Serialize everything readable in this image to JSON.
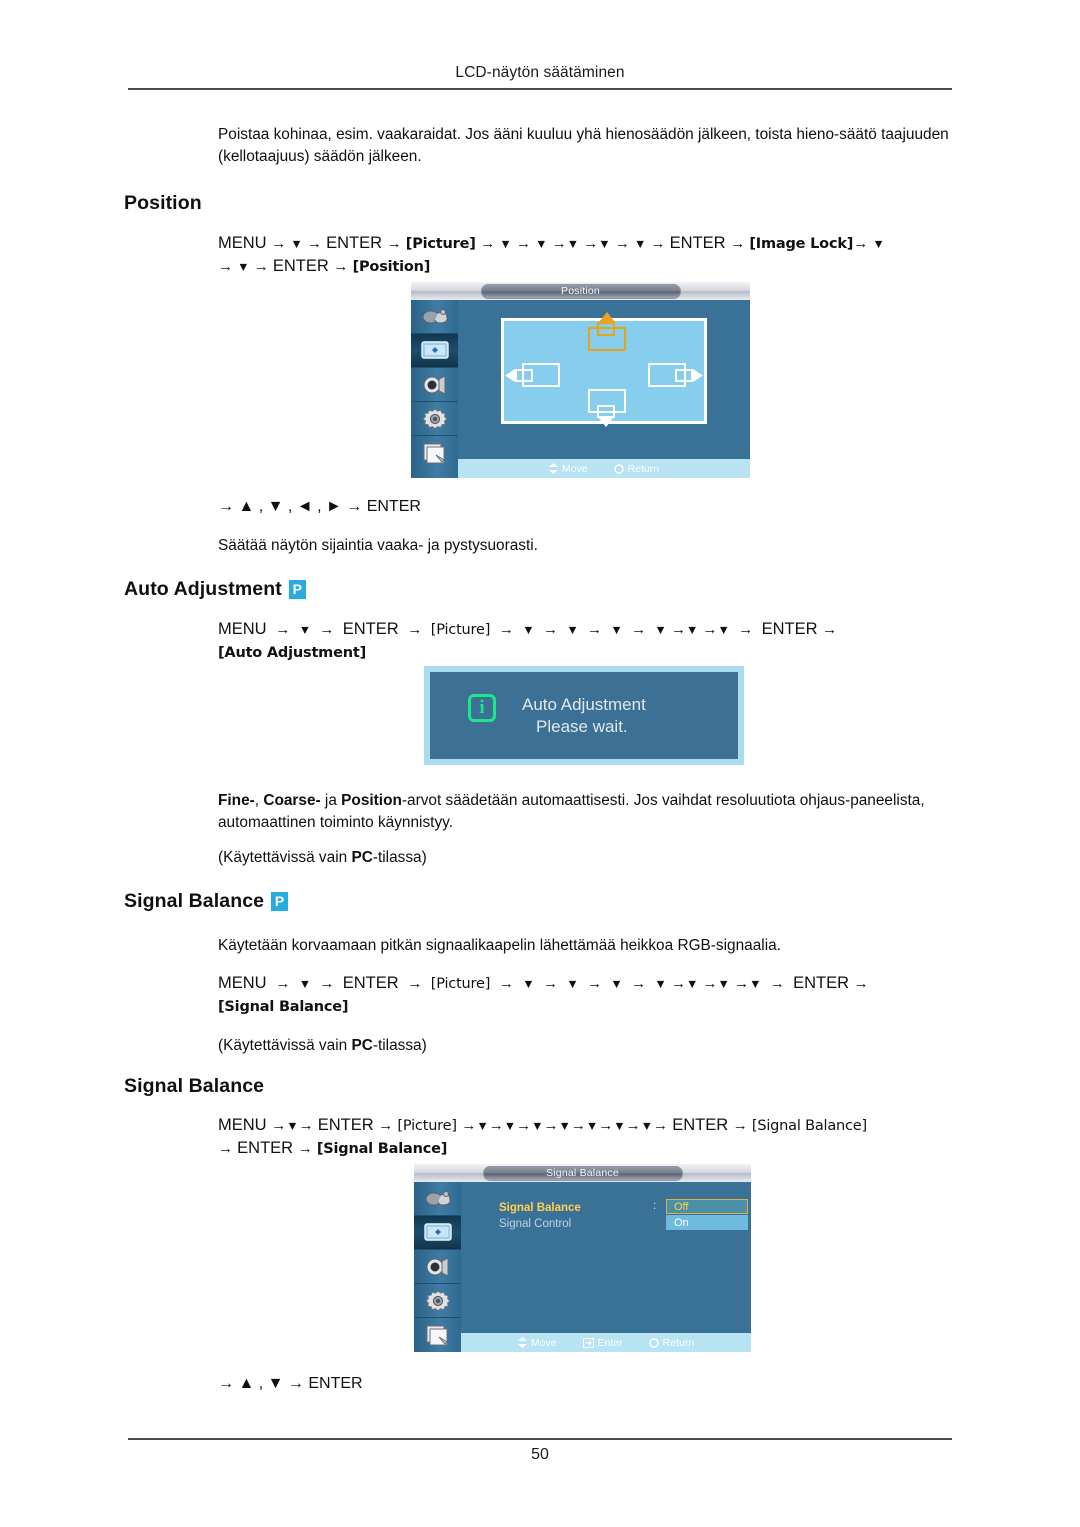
{
  "header": {
    "running_title": "LCD-näytön säätäminen",
    "page_number": "50"
  },
  "intro_paragraph": "Poistaa kohinaa, esim. vaakaraidat. Jos ääni kuuluu yhä hienosäädön jälkeen, toista hieno-säätö taajuuden (kellotaajuus) säädön jälkeen.",
  "sections": {
    "position": {
      "heading": "Position",
      "nav_line1": {
        "menu": "MENU",
        "enter1": "ENTER",
        "token_picture": "[Picture]",
        "enter2": "ENTER",
        "token_image_lock": "[Image Lock]"
      },
      "nav_line2": {
        "enter": "ENTER",
        "token_position": "[Position]"
      },
      "key_hint": "→ ▲ , ▼ , ◄ , ► → ENTER",
      "description": "Säätää näytön sijaintia vaaka- ja pystysuorasti.",
      "osd": {
        "title": "Position",
        "footer_move": "Move",
        "footer_return": "Return"
      }
    },
    "auto_adjustment": {
      "heading": "Auto Adjustment",
      "badge": "P",
      "nav_line1": {
        "menu": "MENU",
        "enter1": "ENTER",
        "token_picture": "[Picture]",
        "enter2": "ENTER"
      },
      "nav_line2": {
        "token_auto_adjustment": "[Auto Adjustment]"
      },
      "panel": {
        "icon": "i",
        "line1": "Auto Adjustment",
        "line2": "Please wait."
      },
      "paragraph": "Fine-, Coarse- ja Position-arvot säädetään automaattisesti. Jos vaihdat resoluutiota ohjaus-paneelista, automaattinen toiminto käynnistyy.",
      "paragraph_bold": [
        "Fine-",
        "Coarse-",
        "Position"
      ],
      "note": "(Käytettävissä vain PC-tilassa)",
      "note_bold": "PC"
    },
    "signal_balance_1": {
      "heading": "Signal Balance",
      "badge": "P",
      "description": "Käytetään korvaamaan pitkän signaalikaapelin lähettämää heikkoa RGB-signaalia.",
      "nav_line1": {
        "menu": "MENU",
        "enter1": "ENTER",
        "token_picture": "[Picture]",
        "enter2": "ENTER"
      },
      "nav_line2": {
        "token_signal_balance": "[Signal Balance]"
      },
      "note": "(Käytettävissä vain PC-tilassa)",
      "note_bold": "PC"
    },
    "signal_balance_2": {
      "heading": "Signal Balance",
      "nav_line1": {
        "menu": "MENU",
        "enter1": "ENTER",
        "token_picture": "[Picture]",
        "enter2": "ENTER",
        "token_signal_balance": "[Signal Balance]"
      },
      "nav_line2": {
        "enter": "ENTER",
        "token_signal_balance": "[Signal Balance]"
      },
      "key_hint": "→ ▲ , ▼ → ENTER",
      "osd": {
        "title": "Signal Balance",
        "row1_label": "Signal Balance",
        "row2_label": "Signal Control",
        "colon": ":",
        "option_off": "Off",
        "option_on": "On",
        "footer_move": "Move",
        "footer_enter": "Enter",
        "footer_return": "Return"
      }
    }
  },
  "colors": {
    "badge_blue": "#29abe2",
    "osd_background": "#3a7197",
    "osd_footer": "#b7e3f2",
    "osd_selected_yellow": "#ffd24a",
    "osd_option_on": "#6fbbe0",
    "auto_panel_border": "#a9dcee",
    "auto_panel_body": "#3d7095",
    "auto_icon_green": "#1ce68c"
  },
  "icons": {
    "menu_sidebar": [
      "input-jack-icon",
      "picture-monitor-icon",
      "sound-speaker-icon",
      "setup-gear-icon",
      "multi-control-pages-icon"
    ],
    "footer_move": "move-updown-icon",
    "footer_enter": "enter-key-icon",
    "footer_return": "return-arrow-icon"
  }
}
